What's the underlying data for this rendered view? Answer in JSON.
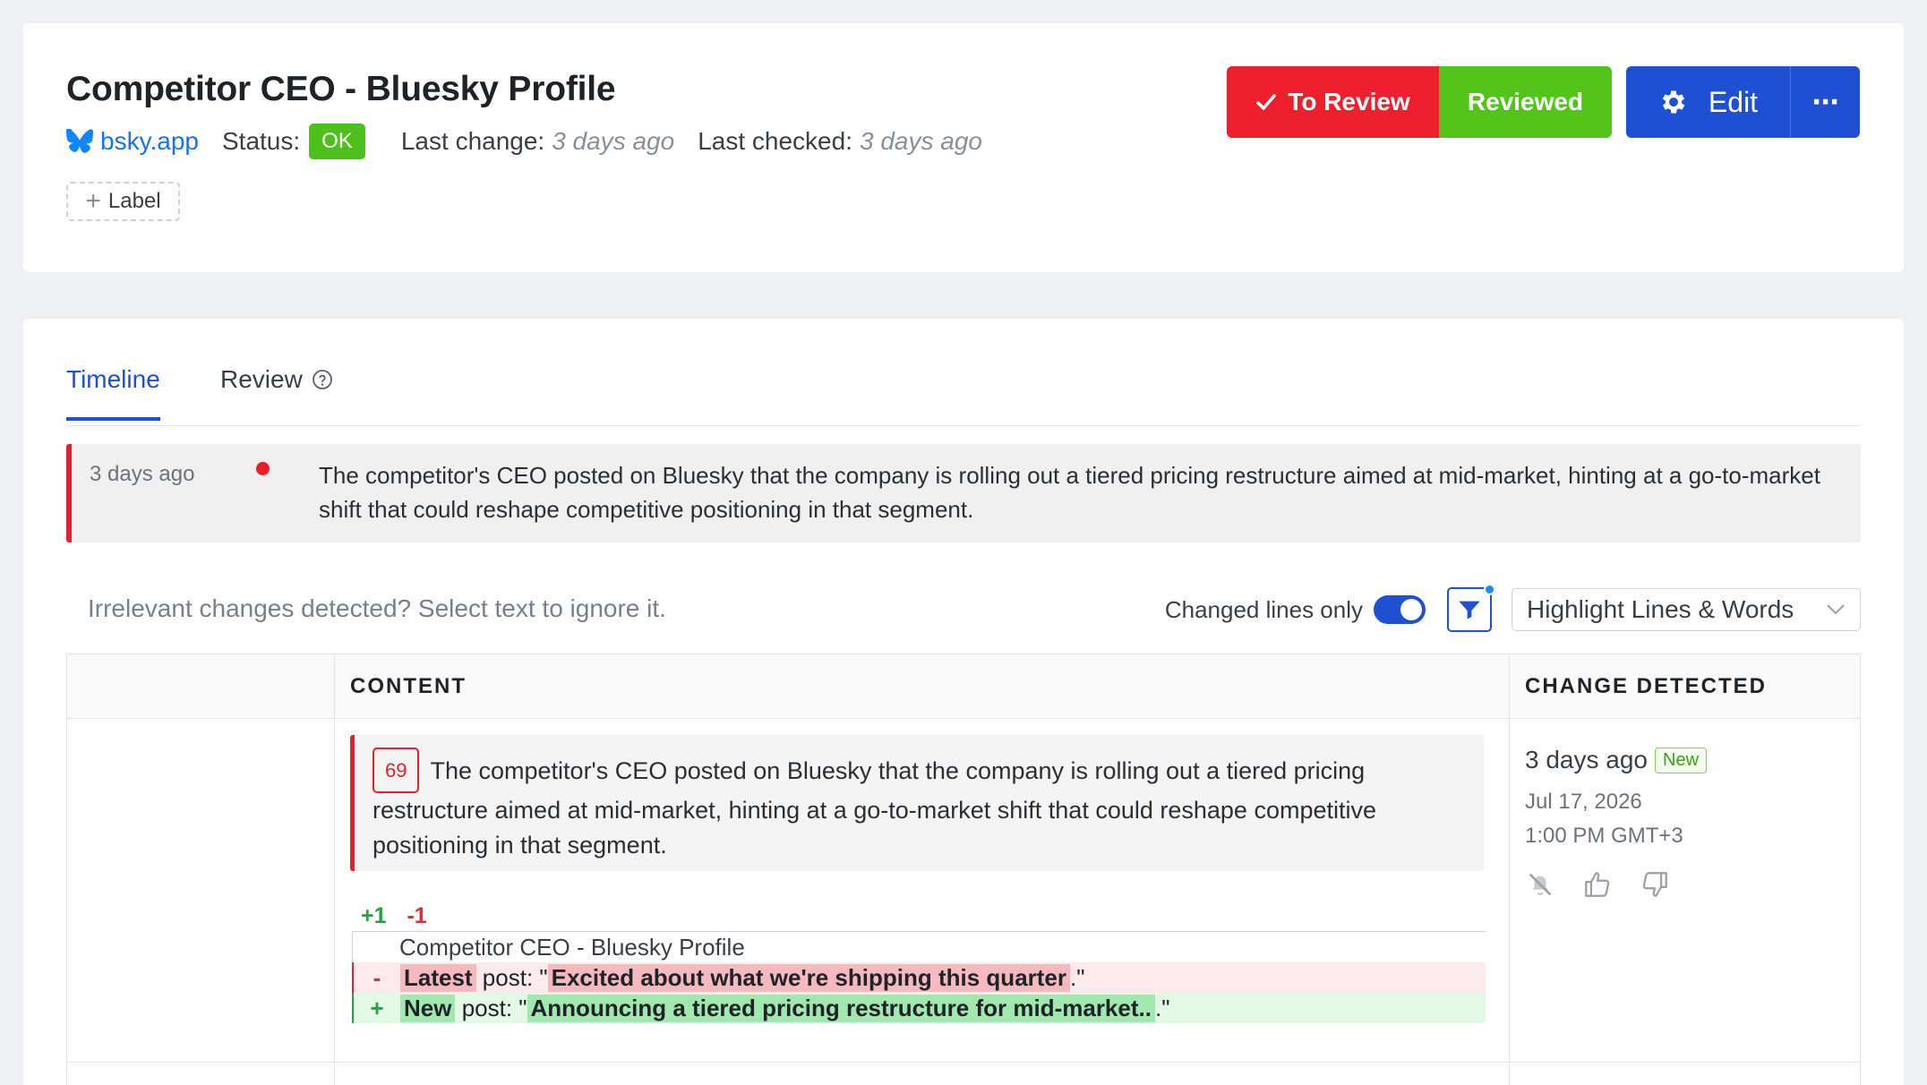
{
  "header": {
    "title": "Competitor CEO - Bluesky Profile",
    "site": "bsky.app",
    "status_label": "Status:",
    "status_value": "OK",
    "last_change_label": "Last change:",
    "last_change_value": "3 days ago",
    "last_checked_label": "Last checked:",
    "last_checked_value": "3 days ago",
    "label_button": "Label",
    "to_review_button": "To Review",
    "reviewed_button": "Reviewed",
    "edit_button": "Edit",
    "more_button": "⋯",
    "colors": {
      "to_review": "#ef1f2d",
      "reviewed": "#52c41a",
      "edit": "#1f4fd2",
      "status_ok": "#4ec01d"
    }
  },
  "tabs": [
    {
      "label": "Timeline",
      "active": true
    },
    {
      "label": "Review",
      "active": false,
      "icon": "help-circle-icon"
    }
  ],
  "event": {
    "time": "3 days ago",
    "summary": "The competitor's CEO posted on Bluesky that the company is rolling out a tiered pricing restructure aimed at mid-market, hinting at a go-to-market shift that could reshape competitive positioning in that segment."
  },
  "toolbar": {
    "hint": "Irrelevant changes detected? Select text to ignore it.",
    "changed_lines_label": "Changed lines only",
    "changed_lines_on": true,
    "highlight_mode": "Highlight Lines & Words"
  },
  "table": {
    "headers": {
      "content": "CONTENT",
      "change": "CHANGE DETECTED"
    },
    "row": {
      "score": "69",
      "summary": "The competitor's CEO posted on Bluesky that the company is rolling out a tiered pricing restructure aimed at mid-market, hinting at a go-to-market shift that could reshape competitive positioning in that segment.",
      "added_count": "+1",
      "removed_count": "-1",
      "context_line": "Competitor CEO - Bluesky Profile",
      "removed_line": {
        "sign": "-",
        "word": "Latest",
        "mid": " post: \"",
        "phrase": "Excited about what we're shipping this quarter",
        "end": ".\""
      },
      "added_line": {
        "sign": "+",
        "word": "New",
        "mid": " post: \"",
        "phrase": "Announcing a tiered pricing restructure for mid-market..",
        "end": ".\""
      },
      "change_relative": "3 days ago",
      "new_badge": "New",
      "change_date": "Jul 17, 2026",
      "change_time": "1:00 PM GMT+3"
    }
  }
}
